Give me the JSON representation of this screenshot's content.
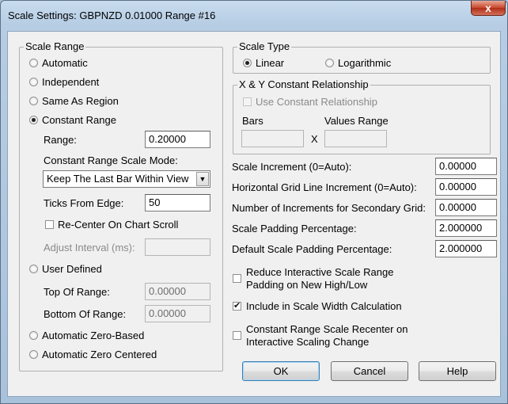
{
  "window": {
    "title": "Scale Settings: GBPNZD  0.01000 Range  #16",
    "close_glyph": "x"
  },
  "scale_range": {
    "legend": "Scale Range",
    "options": {
      "automatic": "Automatic",
      "independent": "Independent",
      "same_as_region": "Same As Region",
      "constant_range": "Constant Range",
      "user_defined": "User Defined",
      "automatic_zero_based": "Automatic Zero-Based",
      "automatic_zero_centered": "Automatic Zero Centered"
    },
    "selected": "constant_range",
    "range_label": "Range:",
    "range_value": "0.20000",
    "mode_label": "Constant Range Scale Mode:",
    "mode_value": "Keep The Last Bar Within View",
    "ticks_label": "Ticks From Edge:",
    "ticks_value": "50",
    "recenter_label": "Re-Center On Chart Scroll",
    "recenter_checked": false,
    "adjust_label": "Adjust Interval (ms):",
    "adjust_value": "",
    "top_label": "Top Of Range:",
    "top_value": "0.00000",
    "bottom_label": "Bottom Of Range:",
    "bottom_value": "0.00000"
  },
  "scale_type": {
    "legend": "Scale Type",
    "linear": "Linear",
    "logarithmic": "Logarithmic",
    "selected": "linear"
  },
  "xy_relationship": {
    "legend": "X & Y Constant Relationship",
    "use_label": "Use Constant Relationship",
    "bars_label": "Bars",
    "values_label": "Values Range",
    "x_label": "X",
    "bars_value": "",
    "values_value": ""
  },
  "fields": {
    "scale_increment_label": "Scale Increment (0=Auto):",
    "scale_increment_value": "0.00000",
    "hgrid_label": "Horizontal Grid Line Increment (0=Auto):",
    "hgrid_value": "0.00000",
    "secondary_grid_label": "Number of Increments for Secondary Grid:",
    "secondary_grid_value": "0.00000",
    "padding_label": "Scale Padding Percentage:",
    "padding_value": "2.000000",
    "default_padding_label": "Default Scale Padding Percentage:",
    "default_padding_value": "2.000000"
  },
  "options": {
    "reduce_padding_line1": "Reduce Interactive Scale Range",
    "reduce_padding_line2": "Padding on New High/Low",
    "reduce_padding_checked": false,
    "include_width_label": "Include in Scale Width Calculation",
    "include_width_checked": true,
    "recenter_line1": "Constant Range Scale Recenter on",
    "recenter_line2": "Interactive Scaling Change",
    "recenter_checked": false
  },
  "buttons": {
    "ok": "OK",
    "cancel": "Cancel",
    "help": "Help"
  },
  "glyphs": {
    "check": "✔",
    "dropdown": "▼"
  }
}
